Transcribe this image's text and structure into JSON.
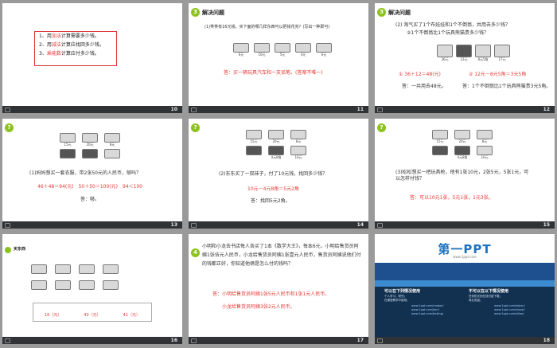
{
  "slide10": {
    "num": "10",
    "items": [
      "1、用加法计算需要多少钱。",
      "2、用减法计算应找回多少钱。",
      "3、乘能数计算应付多少钱。"
    ]
  },
  "slide11": {
    "num": "11",
    "badge": "3",
    "title": "解决问题",
    "q": "(1)笑笑有16元钱，买下面的哪几样东西可以把钱花完？(写出一种即可)",
    "prices": [
      "6元",
      "10元",
      "5元",
      "4元",
      "6元"
    ],
    "answer": "答：买一辆玩具汽车和一支铅笔。(答案不唯一)"
  },
  "slide12": {
    "num": "12",
    "badge": "3",
    "title": "解决问题",
    "q1": "(2) 淘气买了1个布娃娃和1个不倒翁，共用去多少钱？",
    "q2": "②1个不倒翁比1个玩具熊猫贵多少钱？",
    "prices": [
      "36元",
      "12元",
      "8元5角",
      "17元"
    ],
    "a1": "① 36＋12＝48(元)",
    "a2": "② 12元－8元5角＝3元5角",
    "ans1": "答：一共用去48元。",
    "ans2": "答：1个不倒翁比1个玩具熊猫贵3元5角。"
  },
  "slide13": {
    "num": "13",
    "badge": "?",
    "prices": [
      "15元",
      "20元",
      "8元"
    ],
    "q": "(1)妈妈想买一套衣服，带2张50元的人民币，够吗？",
    "calc": "46＋48＝94(元)　50＋50＝100(元)　94＜100",
    "ans": "答：够。"
  },
  "slide14": {
    "num": "14",
    "badge": "?",
    "prices": [
      "15元",
      "20元",
      "8元",
      "4元8角",
      "10元"
    ],
    "q": "(2)东东买了一双袜子，付了10元钱，找回多少钱？",
    "calc": "10元－4元8角＝5元2角",
    "ans": "答：找回5元2角。"
  },
  "slide15": {
    "num": "15",
    "badge": "?",
    "prices": [
      "15元",
      "20元",
      "8元",
      "4元8角",
      "10元"
    ],
    "q": "(3)松松想买一把玩具枪，他有1张10元，2张5元，5张1元，可以怎样付钱？",
    "ans": "答：可以10元1张，5元1张，1元3张。"
  },
  "slide16": {
    "num": "16",
    "title": "买东西",
    "totals": [
      "16（元）",
      "40（元）",
      "41（元）"
    ]
  },
  "slide17": {
    "num": "17",
    "badge": "4",
    "q": "小明和小龙去书店每人各买了1本《数学大王》，每本6元，小明给售货员阿姨1张伍元人民币，小龙给售货员阿姨1张壹元人民币，售货员阿姨说他们付的钱都正好，你知道他俩是怎么付的钱吗？",
    "a1": "答：小明给售货员阿姨1张5元人民币和1张1元人民币，",
    "a2": "小龙给售货员阿姨3张2元人民币。"
  },
  "slide18": {
    "num": "18",
    "logo": "第一PPT",
    "sub": "www.1ppt.com",
    "left_title": "可以在下列情况使用",
    "right_title": "不可以在以下情况使用",
    "left_lines": [
      "个人学习、研究；",
      "在课堂教学中使用；"
    ],
    "right_lines": [
      "任何形式的在线付费下载；",
      "商业用途；"
    ],
    "links": [
      "www.1ppt.com/moban/",
      "www.1ppt.com/jieri/",
      "www.1ppt.com/beijing/",
      "www.1ppt.com/kejian/",
      "www.1ppt.com/xiazai/",
      "www.1ppt.com/ziliao/"
    ]
  }
}
